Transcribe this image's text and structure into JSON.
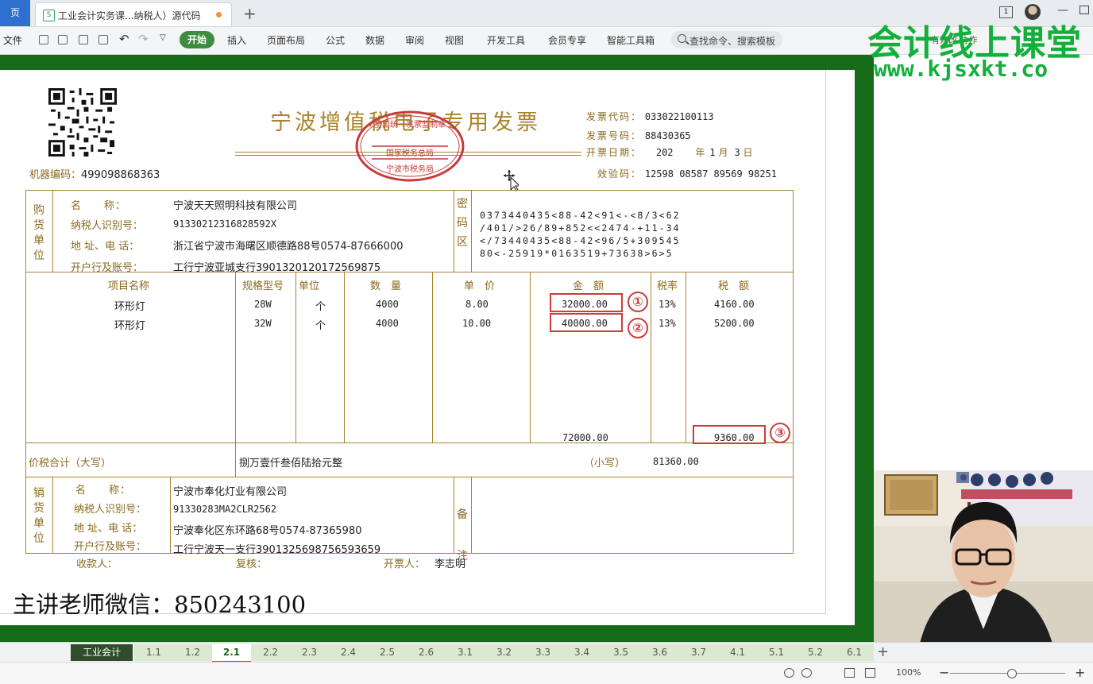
{
  "titlebar": {
    "home_tab": "页",
    "doc_tab": "工业会计实务课...纳税人）源代码",
    "page_indicator": "1"
  },
  "menu": {
    "file": "文件",
    "start": "开始",
    "items": [
      "插入",
      "页面布局",
      "公式",
      "数据",
      "审阅",
      "视图",
      "开发工具",
      "会员专享",
      "智能工具箱"
    ],
    "search_placeholder": "查找命令、搜索模板",
    "right_text": "有修改  协作"
  },
  "watermark": {
    "line1": "会计线上课堂",
    "line2": "www.kjsxkt.co"
  },
  "invoice": {
    "title": "宁波增值税电子专用发票",
    "seal_lines": [
      "全国统一发票监制章",
      "国家税务总局",
      "宁波市税务局"
    ],
    "machine_code_label": "机器编码：",
    "machine_code": "499098868363",
    "code_label": "发票代码：",
    "code": "033022100113",
    "number_label": "发票号码：",
    "number": "88430365",
    "date_label": "开票日期：",
    "date_year": "202",
    "date_year_label": "年",
    "date_month": "1",
    "date_month_label": "月",
    "date_day": "3",
    "date_day_label": "日",
    "check_label": "效验码：",
    "check_code": "12598 08587 89569 98251",
    "buyer": {
      "side": "购货单位",
      "name_label": "名　　称：",
      "name": "宁波天天照明科技有限公司",
      "tax_label": "纳税人识别号：",
      "tax_id": "91330212316828592X",
      "addr_label": "地 址、电 话：",
      "addr": "浙江省宁波市海曙区顺德路88号0574-87666000",
      "bank_label": "开户行及账号：",
      "bank": "工行宁波亚城支行3901320120172569875"
    },
    "cipher_label": "密码区",
    "cipher_lines": [
      "0373440435<88-42<91<-<8/3<62",
      "/401/>26/89+852<<2474-+11-34",
      "</73440435<88-42<96/5+309545",
      "80<-25919*0163519+73638>6>5"
    ],
    "columns": [
      "项目名称",
      "规格型号",
      "单位",
      "数　量",
      "单　价",
      "金　额",
      "税率",
      "税　额"
    ],
    "rows": [
      {
        "name": "环形灯",
        "spec": "28W",
        "unit": "个",
        "qty": "4000",
        "price": "8.00",
        "amount": "32000.00",
        "rate": "13%",
        "tax": "4160.00"
      },
      {
        "name": "环形灯",
        "spec": "32W",
        "unit": "个",
        "qty": "4000",
        "price": "10.00",
        "amount": "40000.00",
        "rate": "13%",
        "tax": "5200.00"
      }
    ],
    "total_amount": "72000.00",
    "total_tax": "9360.00",
    "sum_label": "价税合计（大写）",
    "sum_words": "捌万壹仟叁佰陆拾元整",
    "small_label": "（小写）",
    "sum_small": "81360.00",
    "seller": {
      "side": "销货单位",
      "name_label": "名　　称：",
      "name": "宁波市奉化灯业有限公司",
      "tax_label": "纳税人识别号：",
      "tax_id": "91330283MA2CLR2562",
      "addr_label": "地 址、电 话：",
      "addr": "宁波奉化区东环路68号0574-87365980",
      "bank_label": "开户行及账号：",
      "bank": "工行宁波天一支行3901325698756593659"
    },
    "remark_label": "备注",
    "payee_label": "收款人：",
    "reviewer_label": "复核：",
    "drawer_label": "开票人：",
    "drawer": "李志明",
    "markers": [
      "①",
      "②",
      "③"
    ]
  },
  "teacher_wechat": "主讲老师微信：850243100",
  "sheet_tabs": [
    "工业会计",
    "1.1",
    "1.2",
    "2.1",
    "2.2",
    "2.3",
    "2.4",
    "2.5",
    "2.6",
    "3.1",
    "3.2",
    "3.3",
    "3.4",
    "3.5",
    "3.6",
    "3.7",
    "4.1",
    "5.1",
    "5.2",
    "6.1"
  ],
  "active_sheet": "2.1",
  "status": {
    "zoom": "100%"
  },
  "colors": {
    "ribbon_green": "#3d8c40",
    "frame_green": "#166b19",
    "invoice_line": "#a9822b",
    "highlight_red": "#d03a3a",
    "watermark": "#12b03a"
  }
}
